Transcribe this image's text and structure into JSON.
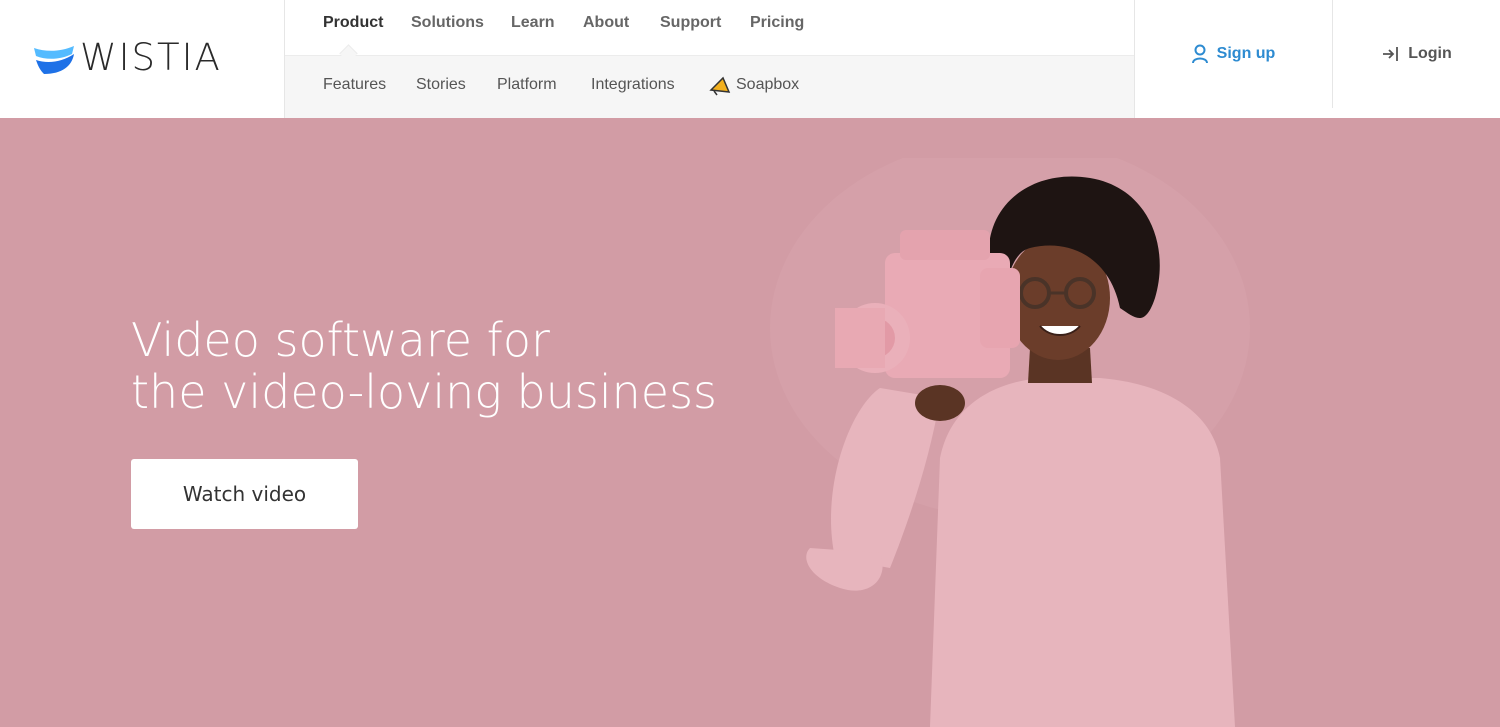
{
  "brand": {
    "name": "WISTIA",
    "logo_icon": "wistia-wave-icon",
    "accent": "#2d8bd1"
  },
  "nav": {
    "primary": [
      {
        "label": "Product",
        "active": true
      },
      {
        "label": "Solutions"
      },
      {
        "label": "Learn"
      },
      {
        "label": "About"
      },
      {
        "label": "Support"
      },
      {
        "label": "Pricing"
      }
    ],
    "secondary": [
      {
        "label": "Features"
      },
      {
        "label": "Stories"
      },
      {
        "label": "Platform"
      },
      {
        "label": "Integrations"
      },
      {
        "label": "Soapbox",
        "icon": "soapbox-megaphone-icon"
      }
    ]
  },
  "auth": {
    "signup_label": "Sign up",
    "signup_icon": "user-icon",
    "login_label": "Login",
    "login_icon": "login-arrow-icon"
  },
  "hero": {
    "headline_line1": "Video software for",
    "headline_line2": "the video-loving business",
    "cta_label": "Watch video",
    "background": "#d29ca5"
  }
}
